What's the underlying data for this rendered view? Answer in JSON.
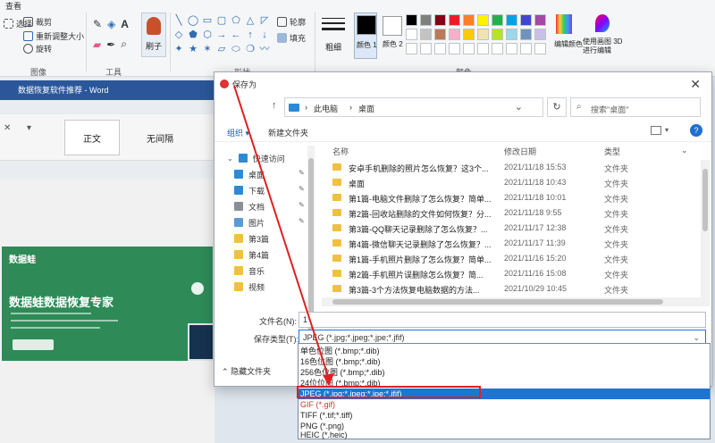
{
  "ribbon": {
    "menu_label": "查看",
    "image_group": {
      "label": "图像",
      "select_label": "选择",
      "crop_label": "裁剪",
      "resize_label": "重新调整大小",
      "rotate_label": "旋转"
    },
    "tools_group": {
      "label": "工具"
    },
    "brushes_label": "刷子",
    "shapes_group": {
      "label": "形状",
      "outline_label": "轮廓",
      "fill_label": "填充",
      "shapes": [
        "╲",
        "◯",
        "▭",
        "▢",
        "⬠",
        "△",
        "◸",
        "◇",
        "⬟",
        "⬡",
        "→",
        "←",
        "↑",
        "↓",
        "✦",
        "★",
        "✶",
        "▱",
        "⬭",
        "❍",
        "〰"
      ]
    },
    "size_label": "粗细",
    "colors_group": {
      "label": "颜色",
      "color1_label": "颜色 1",
      "color2_label": "颜色 2",
      "edit_colors_label": "编辑颜色",
      "paint3d_label": "使用画图 3D 进行编辑",
      "color1": "#000000",
      "color2": "#ffffff",
      "palette": [
        "#000000",
        "#7f7f7f",
        "#880015",
        "#ed1c24",
        "#ff7f27",
        "#fff200",
        "#22b14c",
        "#00a2e8",
        "#3f48cc",
        "#a349a4",
        "#ffffff",
        "#c3c3c3",
        "#b97a57",
        "#ffaec9",
        "#ffc90e",
        "#efe4b0",
        "#b5e61d",
        "#99d9ea",
        "#7092be",
        "#c8bfe7",
        "#ffffff",
        "#ffffff",
        "#ffffff",
        "#ffffff",
        "#ffffff",
        "#ffffff",
        "#ffffff",
        "#ffffff",
        "#ffffff",
        "#ffffff"
      ]
    }
  },
  "background_window": {
    "title": "数据恢复软件推荐 - Word",
    "style_1": "正文",
    "style_2": "无间隔",
    "promo": {
      "logo": "数据蛙",
      "title": "数据蛙数据恢复专家"
    }
  },
  "dialog": {
    "title": "保存为",
    "close_label": "✕",
    "address": {
      "segment_1": "此电脑",
      "segment_2": "桌面"
    },
    "search_placeholder": "搜索\"桌面\"",
    "commands": {
      "organize": "组织 ▾",
      "new_folder": "新建文件夹"
    },
    "nav_items": [
      {
        "label": "快速访问",
        "color": "#2b8ad6"
      },
      {
        "label": "桌面",
        "color": "#2b8ad6"
      },
      {
        "label": "下载",
        "color": "#2b8ad6"
      },
      {
        "label": "文档",
        "color": "#8a8f96"
      },
      {
        "label": "图片",
        "color": "#5a9ad6"
      },
      {
        "label": "第3篇",
        "color": "#f0c040"
      },
      {
        "label": "第4篇",
        "color": "#f0c040"
      },
      {
        "label": "音乐",
        "color": "#f0c040"
      },
      {
        "label": "视频",
        "color": "#f0c040"
      }
    ],
    "columns": {
      "name": "名称",
      "date": "修改日期",
      "type": "类型"
    },
    "files": [
      {
        "name": "安卓手机删除的照片怎么恢复？这3个...",
        "date": "2021/11/18 15:53",
        "type": "文件夹"
      },
      {
        "name": "桌面",
        "date": "2021/11/18 10:43",
        "type": "文件夹"
      },
      {
        "name": "第1篇-电脑文件删除了怎么恢复？简单...",
        "date": "2021/11/18 10:01",
        "type": "文件夹"
      },
      {
        "name": "第2篇-回收站删除的文件如何恢复？分...",
        "date": "2021/11/18 9:55",
        "type": "文件夹"
      },
      {
        "name": "第3篇-QQ聊天记录删除了怎么恢复？...",
        "date": "2021/11/17 12:38",
        "type": "文件夹"
      },
      {
        "name": "第4篇-微信聊天记录删除了怎么恢复？...",
        "date": "2021/11/17 11:39",
        "type": "文件夹"
      },
      {
        "name": "第1篇-手机照片删除了怎么恢复？简单...",
        "date": "2021/11/16 15:20",
        "type": "文件夹"
      },
      {
        "name": "第2篇-手机照片误删除怎么恢复？简...",
        "date": "2021/11/16 15:08",
        "type": "文件夹"
      },
      {
        "name": "第3篇-3个方法恢复电脑数据的方法...",
        "date": "2021/10/29 10:45",
        "type": "文件夹"
      }
    ],
    "filename_label": "文件名(N):",
    "filename_value": "1",
    "savetype_label": "保存类型(T):",
    "savetype_value": "JPEG (*.jpg;*.jpeg;*.jpe;*.jfif)",
    "hide_folders_label": "隐藏文件夹"
  },
  "dropdown": {
    "items": [
      "单色位图 (*.bmp;*.dib)",
      "16色位图 (*.bmp;*.dib)",
      "256色位图 (*.bmp;*.dib)",
      "24位位图 (*.bmp;*.dib)",
      "JPEG (*.jpg;*.jpeg;*.jpe;*.jfif)",
      "GIF (*.gif)",
      "TIFF (*.tif;*.tiff)",
      "PNG (*.png)",
      "HEIC (*.heic)"
    ],
    "selected_index": 4
  }
}
